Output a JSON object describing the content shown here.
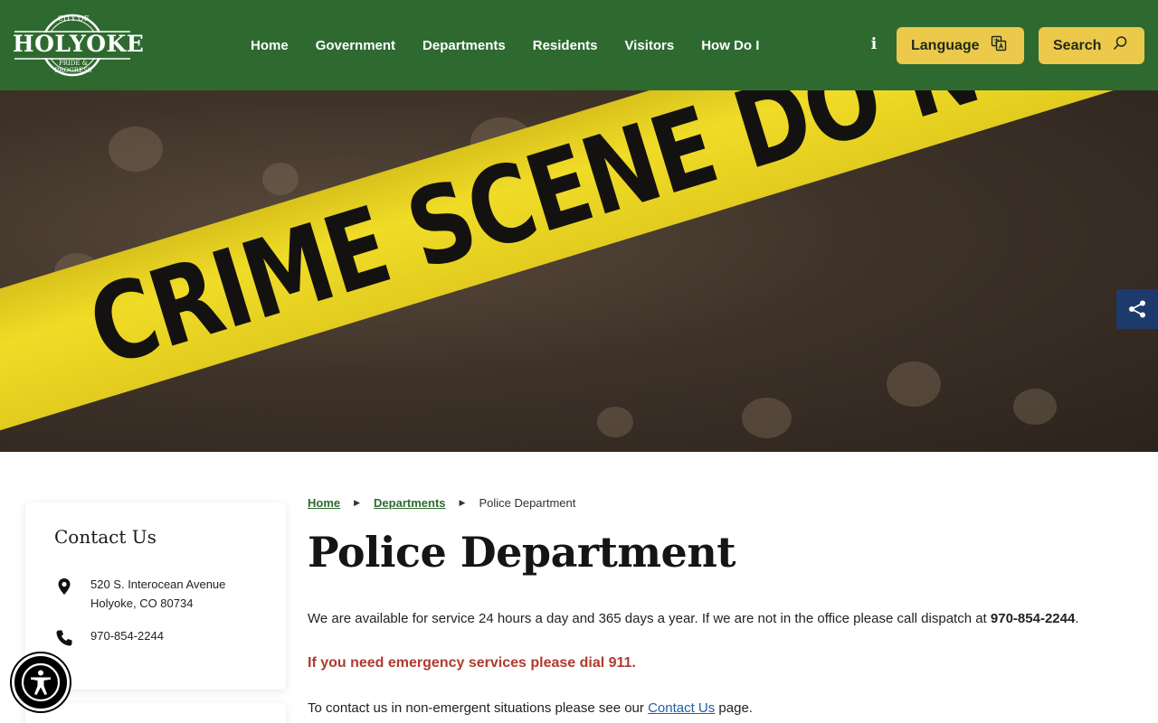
{
  "header": {
    "logo": {
      "top": "CITY OF",
      "name": "HOLYOKE",
      "tagline": "PRIDE & PROGRESS"
    },
    "nav": [
      "Home",
      "Government",
      "Departments",
      "Residents",
      "Visitors",
      "How Do I"
    ],
    "info_icon": "info-icon",
    "language_label": "Language",
    "search_label": "Search",
    "bg_color": "#2e6a2f",
    "button_color": "#ecc94b"
  },
  "hero": {
    "tape_text": "CRIME SCENE DO NOT CROSS",
    "share_icon": "share-icon"
  },
  "sidebar": {
    "title": "Contact Us",
    "address_line1": "520 S. Interocean Avenue",
    "address_line2": "Holyoke, CO 80734",
    "phone": "970-854-2244"
  },
  "breadcrumb": {
    "home": "Home",
    "departments": "Departments",
    "current": "Police Department"
  },
  "main": {
    "title": "Police Department",
    "para1_text": "We are available for service 24 hours a day and 365 days a year. If we are not in the office please call dispatch at ",
    "para1_phone": "970-854-2244",
    "para1_end": ".",
    "emergency": "If you need emergency services please dial 911.",
    "para3_text": "To contact us in non-emergent situations please see our ",
    "para3_link": "Contact Us",
    "para3_end": " page."
  }
}
